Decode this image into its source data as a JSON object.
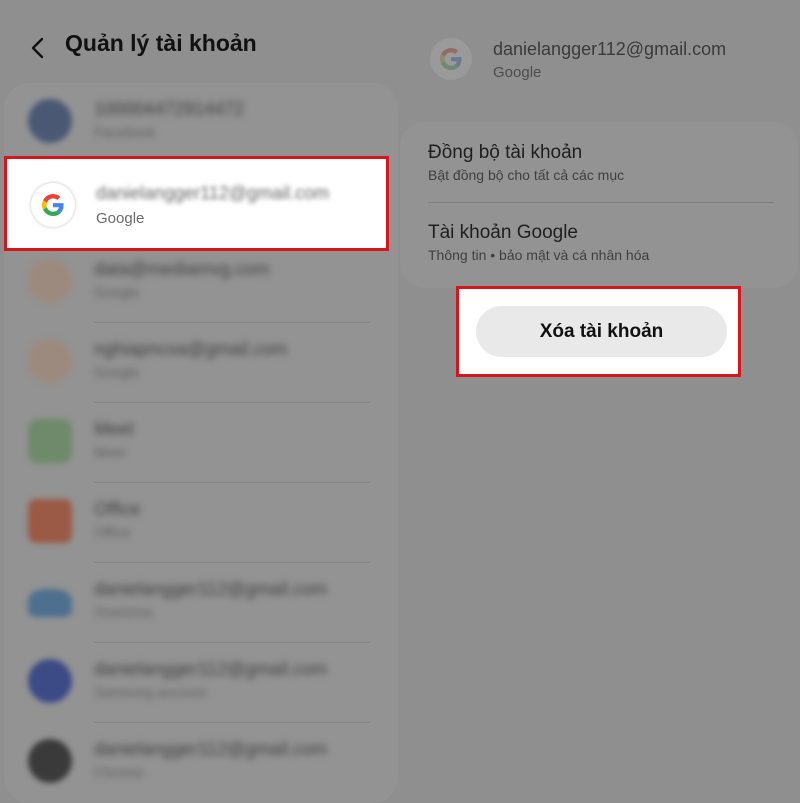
{
  "header": {
    "title": "Quản lý tài khoản"
  },
  "accounts": [
    {
      "title": "100004472914472",
      "subtitle": "Facebook",
      "color": "#4a5873"
    },
    {
      "title": "danielangger112@gmail.com",
      "subtitle": "Google",
      "color": "#ffffff"
    },
    {
      "title": "data@mediamvg.com",
      "subtitle": "Google",
      "color": "#9c8a7e"
    },
    {
      "title": "nghiapncoa@gmail.com",
      "subtitle": "Google",
      "color": "#9c8a7e"
    },
    {
      "title": "Meet",
      "subtitle": "Meet",
      "color": "#6e8a6a"
    },
    {
      "title": "Office",
      "subtitle": "Office",
      "color": "#9a5a45"
    },
    {
      "title": "danielangger112@gmail.com",
      "subtitle": "OneDrive",
      "color": "#4f6f8f"
    },
    {
      "title": "danielangger112@gmail.com",
      "subtitle": "Samsung account",
      "color": "#3c4a86"
    },
    {
      "title": "danielangger112@gmail.com",
      "subtitle": "Chrome",
      "color": "#3a3a3a"
    }
  ],
  "selected_account": {
    "email": "danielangger112@gmail.com",
    "subtitle": "Google"
  },
  "detail": {
    "email": "danielangger112@gmail.com",
    "subtitle": "Google",
    "rows": [
      {
        "title": "Đồng bộ tài khoản",
        "subtitle": "Bật đồng bộ cho tất cả các mục"
      },
      {
        "title": "Tài khoản Google",
        "subtitle": "Thông tin  •  bảo mật và cá nhân hóa"
      }
    ],
    "remove_button": "Xóa tài khoản"
  },
  "colors": {
    "highlight": "#d8151d",
    "dim_overlay": "#8f8f8f"
  },
  "icons": {
    "back": "back-arrow-icon",
    "google": "google-g-icon"
  }
}
